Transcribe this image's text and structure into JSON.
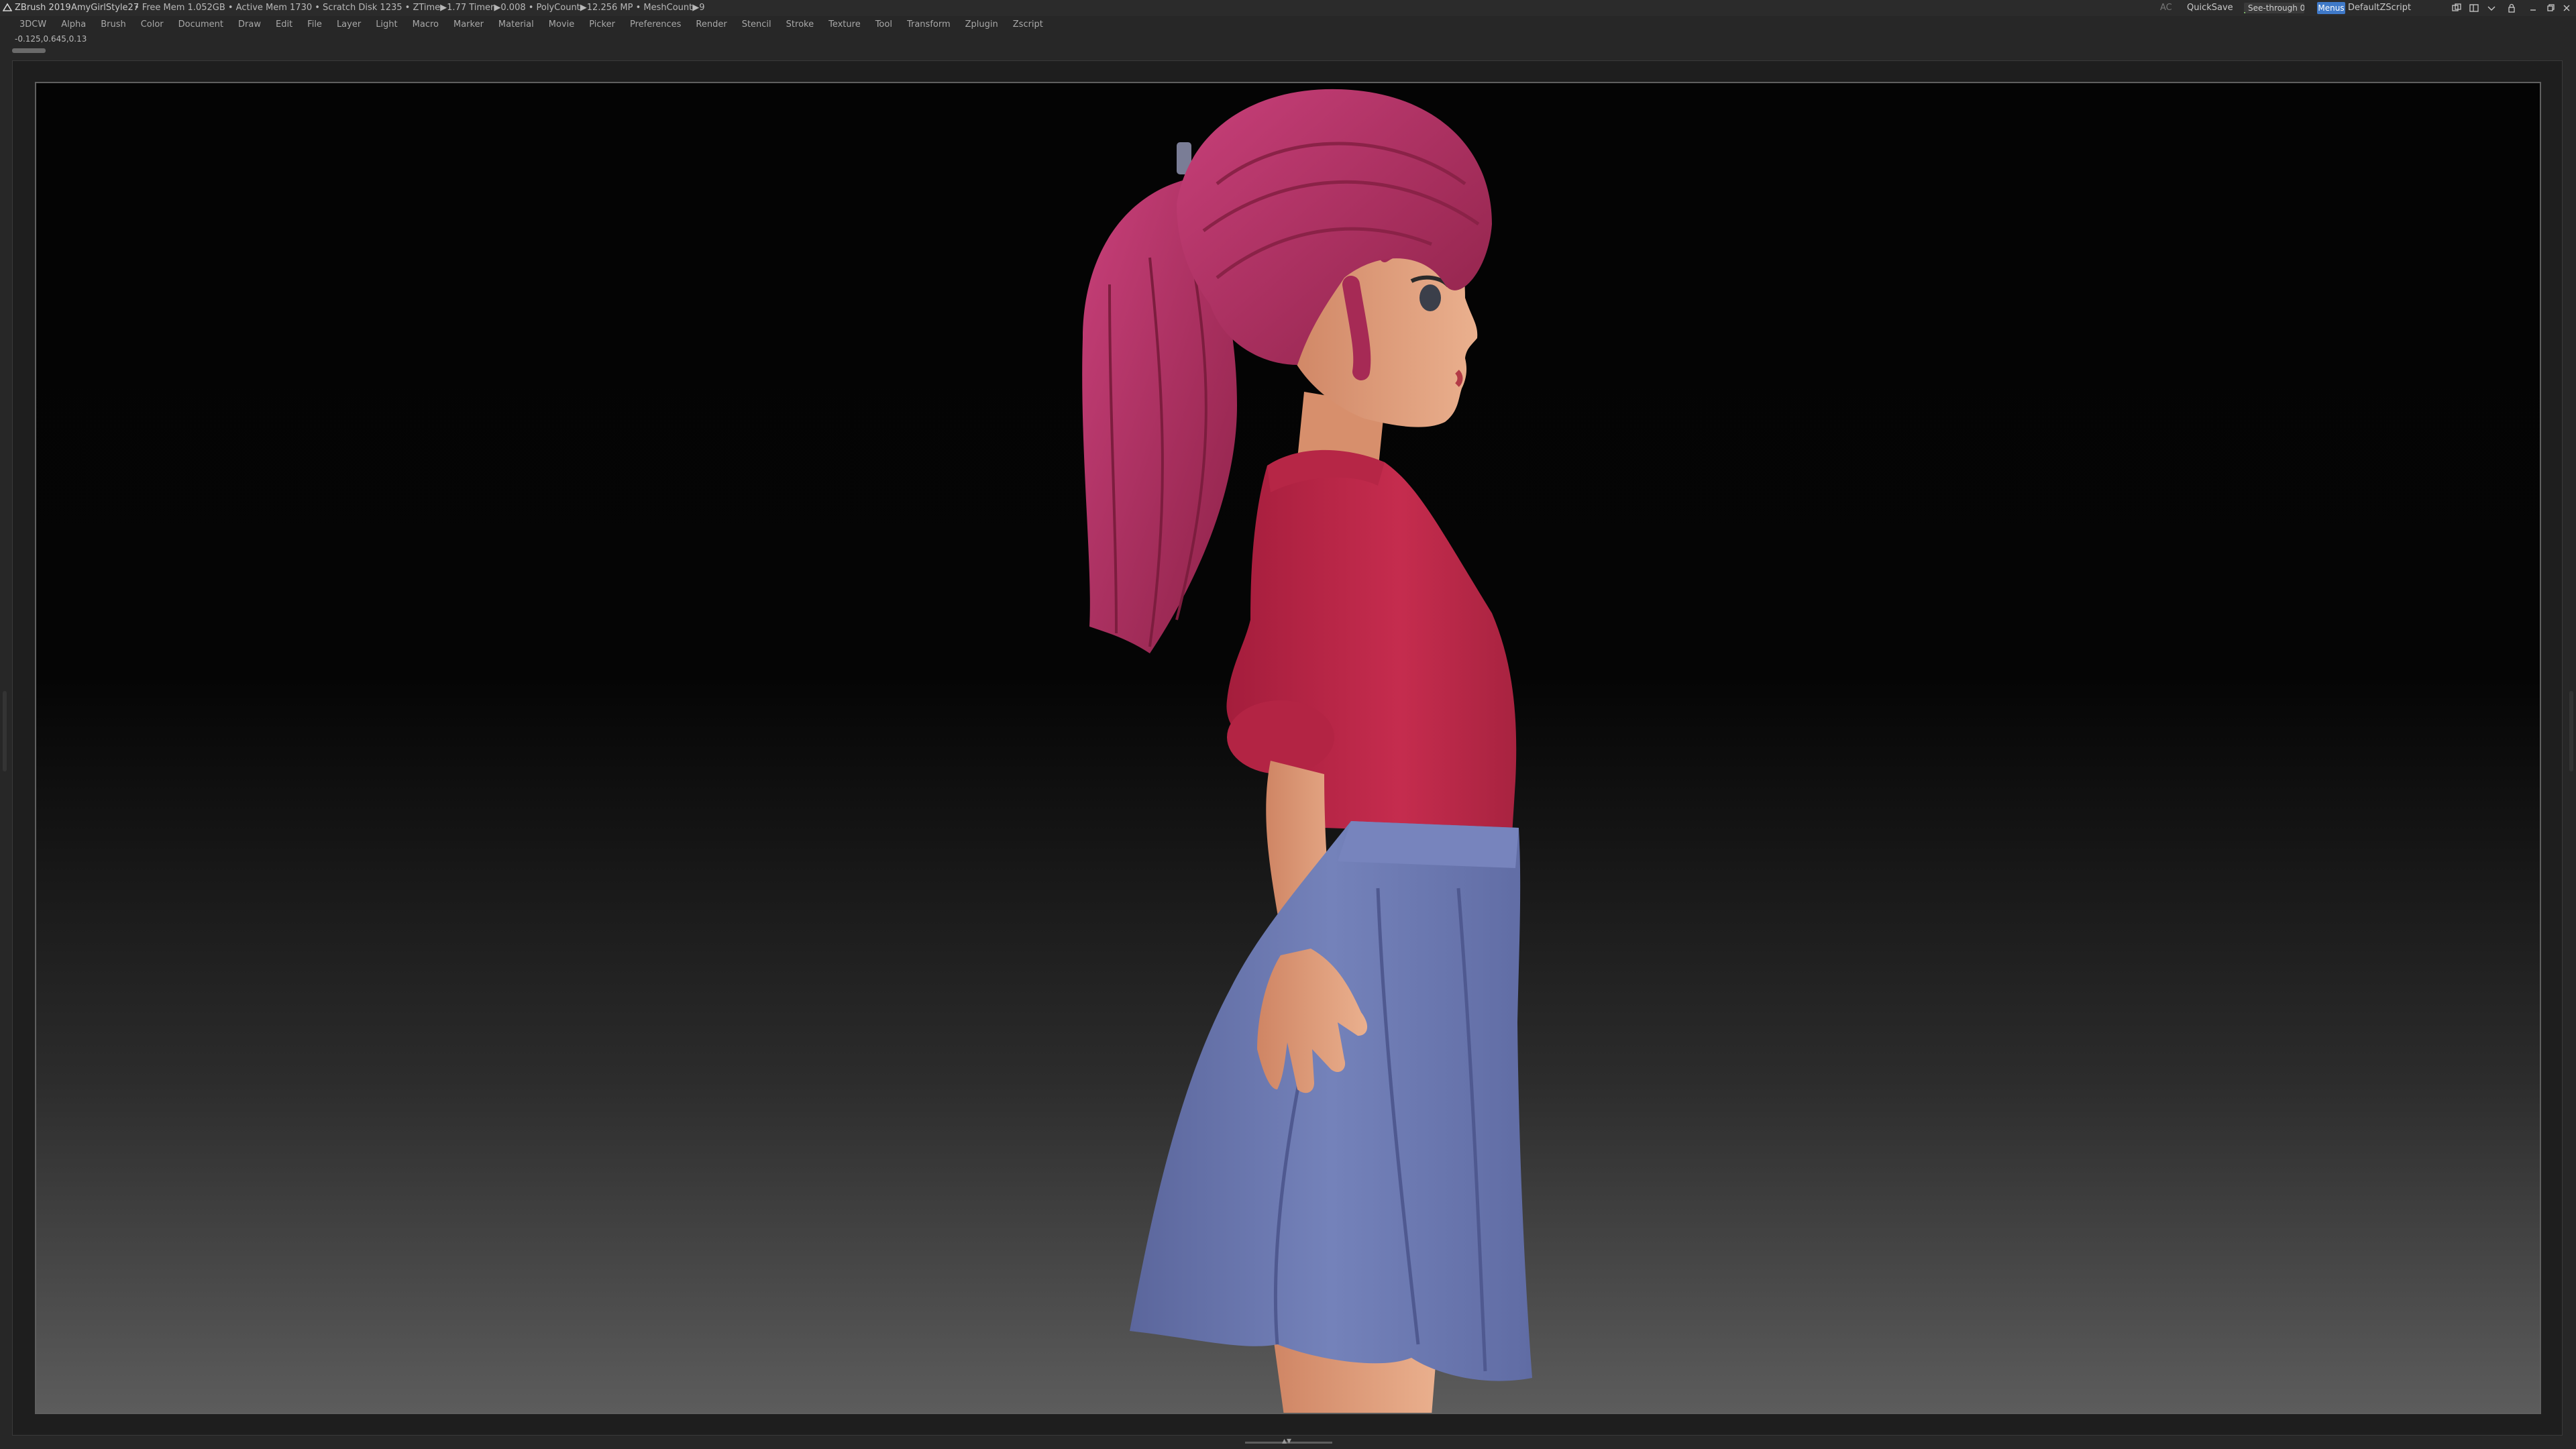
{
  "titlebar": {
    "app_name": "ZBrush 2019",
    "document_name": "AmyGirlStyle27",
    "mem_stats": "• Free Mem 1.052GB • Active Mem 1730 • Scratch Disk 1235 •  ZTime▶1.77 Timer▶0.008 • PolyCount▶12.256 MP • MeshCount▶9",
    "ac_label": "AC",
    "quicksave_label": "QuickSave",
    "see_through_label": "See-through  0",
    "see_through_value": 0.0,
    "menus_label": "Menus",
    "script_label": "DefaultZScript"
  },
  "menubar": {
    "items": [
      "3DCW",
      "Alpha",
      "Brush",
      "Color",
      "Document",
      "Draw",
      "Edit",
      "File",
      "Layer",
      "Light",
      "Macro",
      "Marker",
      "Material",
      "Movie",
      "Picker",
      "Preferences",
      "Render",
      "Stencil",
      "Stroke",
      "Texture",
      "Tool",
      "Transform",
      "Zplugin",
      "Zscript"
    ]
  },
  "subbar": {
    "coords": "-0.125,0.645,0.13"
  },
  "colors": {
    "accent_blue": "#3f79c8",
    "hair": "#b0325e",
    "shirt": "#c02a4c",
    "skirt": "#6f7cb4",
    "skin": "#e3a07c"
  },
  "icons": [
    "zbrush-logo-icon",
    "tile-icon",
    "layout-icon",
    "menu-arrow-icon",
    "lock-icon",
    "minimize-icon",
    "restore-icon",
    "close-icon"
  ]
}
